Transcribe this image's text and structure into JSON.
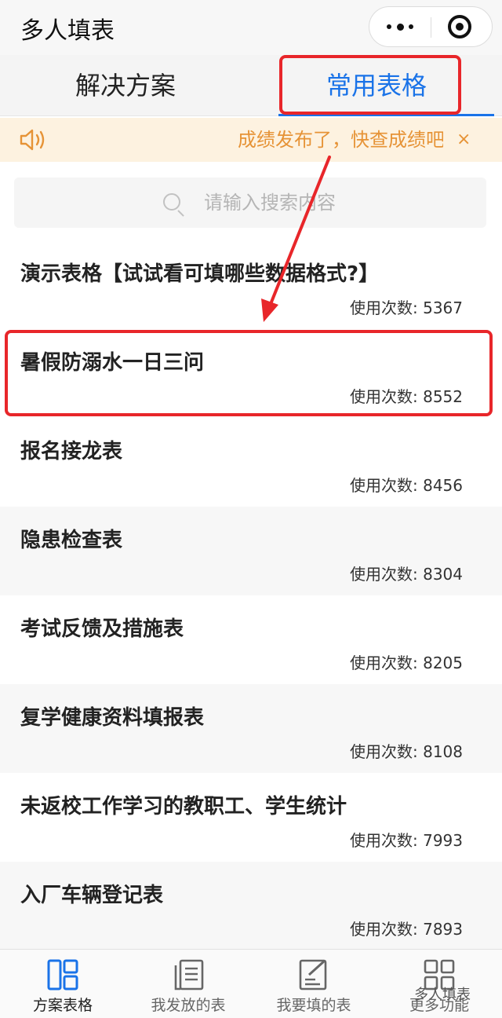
{
  "header": {
    "title": "多人填表"
  },
  "tabs": [
    {
      "label": "解决方案",
      "active": false
    },
    {
      "label": "常用表格",
      "active": true
    }
  ],
  "notice": {
    "text": "成绩发布了，快查成绩吧",
    "close": "×"
  },
  "search": {
    "placeholder": "请输入搜索内容"
  },
  "list": {
    "items": [
      {
        "title": "演示表格【试试看可填哪些数据格式?】",
        "usage_label": "使用次数:",
        "usage": "5367"
      },
      {
        "title": "暑假防溺水一日三问",
        "usage_label": "使用次数:",
        "usage": "8552"
      },
      {
        "title": "报名接龙表",
        "usage_label": "使用次数:",
        "usage": "8456"
      },
      {
        "title": "隐患检查表",
        "usage_label": "使用次数:",
        "usage": "8304"
      },
      {
        "title": "考试反馈及措施表",
        "usage_label": "使用次数:",
        "usage": "8205"
      },
      {
        "title": "复学健康资料填报表",
        "usage_label": "使用次数:",
        "usage": "8108"
      },
      {
        "title": "未返校工作学习的教职工、学生统计",
        "usage_label": "使用次数:",
        "usage": "7993"
      },
      {
        "title": "入厂车辆登记表",
        "usage_label": "使用次数:",
        "usage": "7893"
      }
    ]
  },
  "nav": [
    {
      "label": "方案表格",
      "icon": "grid-layout-icon",
      "active": true
    },
    {
      "label": "我发放的表",
      "icon": "documents-icon",
      "active": false
    },
    {
      "label": "我要填的表",
      "icon": "edit-form-icon",
      "active": false
    },
    {
      "label": "更多功能",
      "icon": "apps-grid-icon",
      "active": false
    }
  ],
  "watermark": "多人填表",
  "colors": {
    "accent": "#1a73e8",
    "notice_bg": "#fdf2e0",
    "notice_text": "#e69336",
    "annotation": "#e8262a"
  }
}
